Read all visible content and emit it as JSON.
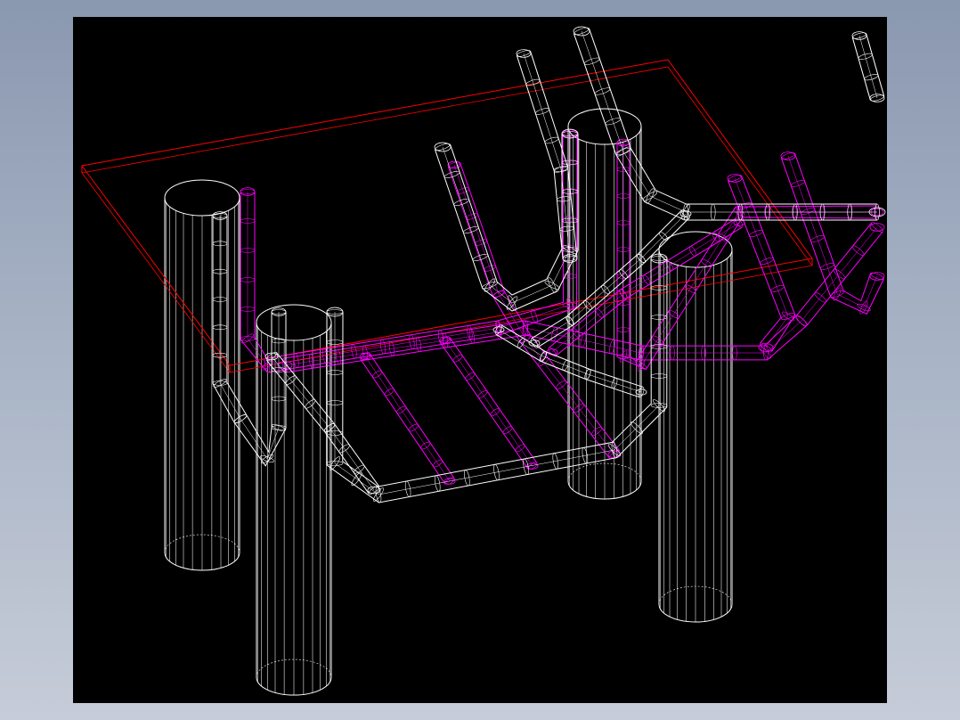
{
  "viewport": {
    "background": "#000000"
  },
  "colors": {
    "slab_outline": "#ff0000",
    "white_rebar": "#ffffff",
    "magenta_rebar": "#ff00ff",
    "pile_wireframe": "#ffffff"
  },
  "scene": {
    "description_visible_text": "",
    "objects": [
      "cad-wireframe-piles",
      "red-pile-cap-outline",
      "white-u-rebar",
      "magenta-u-rebar"
    ]
  }
}
